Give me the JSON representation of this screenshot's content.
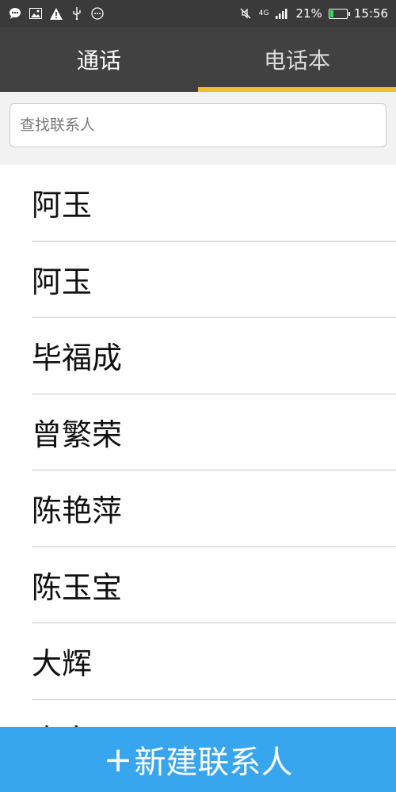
{
  "status_bar": {
    "battery_percent": "21%",
    "time": "15:56",
    "network": "4G",
    "battery_level": 0.21
  },
  "tabs": [
    {
      "label": "通话",
      "active": false
    },
    {
      "label": "电话本",
      "active": true
    }
  ],
  "search": {
    "placeholder": "查找联系人",
    "value": ""
  },
  "contacts": [
    {
      "name": "阿玉"
    },
    {
      "name": "阿玉"
    },
    {
      "name": "毕福成"
    },
    {
      "name": "曾繁荣"
    },
    {
      "name": "陈艳萍"
    },
    {
      "name": "陈玉宝"
    },
    {
      "name": "大辉"
    },
    {
      "name": "大文"
    }
  ],
  "bottom_button": {
    "plus": "+",
    "label": "新建联系人"
  },
  "colors": {
    "tab_bar_bg": "#414141",
    "tab_indicator": "#f3bd2c",
    "button_bg": "#37a6ee"
  }
}
